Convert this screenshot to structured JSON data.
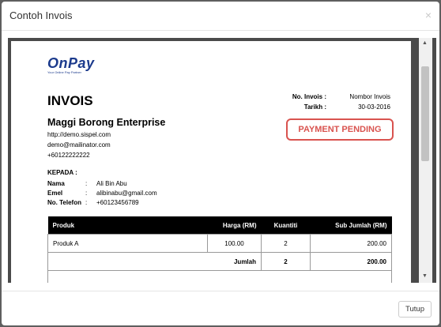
{
  "modal": {
    "title": "Contoh Invois",
    "close_glyph": "×",
    "footer_button": "Tutup"
  },
  "invoice": {
    "logo": "OnPay",
    "logo_tagline": "Your Online Pay Partner",
    "title": "INVOIS",
    "meta": [
      {
        "label": "No. Invois :",
        "value": "Nombor Invois"
      },
      {
        "label": "Tarikh :",
        "value": "30-03-2016"
      }
    ],
    "company": {
      "name": "Maggi Borong Enterprise",
      "website": "http://demo.sispel.com",
      "email": "demo@mailinator.com",
      "phone": "+60122222222"
    },
    "status": "PAYMENT PENDING",
    "recipient_heading": "KEPADA :",
    "recipient": [
      {
        "label": "Nama",
        "value": "Ali Bin Abu"
      },
      {
        "label": "Emel",
        "value": "alibinabu@gmail.com"
      },
      {
        "label": "No. Telefon",
        "value": "+60123456789"
      }
    ],
    "table": {
      "headers": [
        "Produk",
        "Harga (RM)",
        "Kuantiti",
        "Sub Jumlah (RM)"
      ],
      "rows": [
        [
          "Produk A",
          "100.00",
          "2",
          "200.00"
        ]
      ],
      "total_label": "Jumlah",
      "total_qty": "2",
      "total_amount": "200.00"
    }
  },
  "colors": {
    "status": "#d9534f",
    "logo": "#1b3a8c",
    "backdrop": "#5f5f5f"
  }
}
